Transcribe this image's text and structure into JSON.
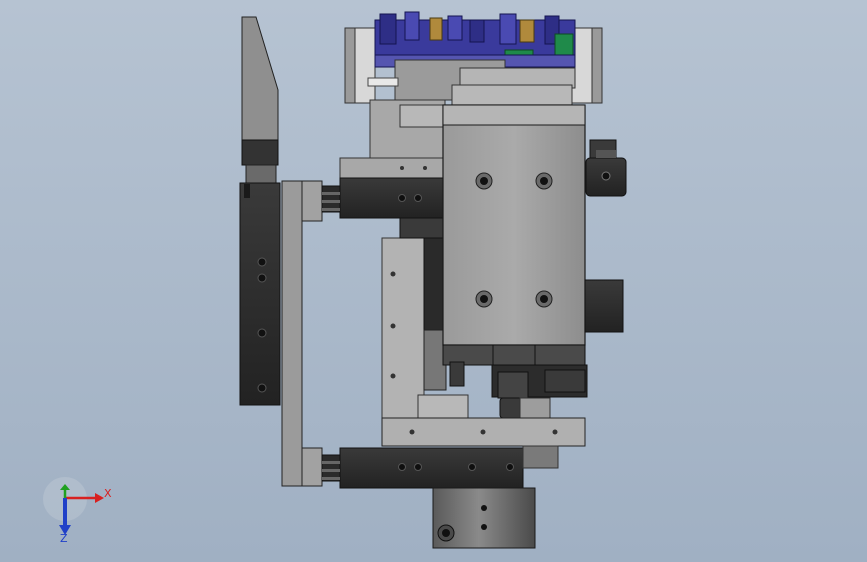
{
  "viewport": {
    "background_top": "#b6c3d2",
    "background_bottom": "#a0b0c3"
  },
  "model": {
    "palette": {
      "steel_light": "#a7a7a7",
      "steel_mid": "#8e8e8e",
      "steel_dark": "#5f5f5f",
      "block_black": "#2d2d2d",
      "edge": "#1a1a1a",
      "fixture_blue": "#3a3a9c",
      "fixture_green": "#1f8a4a",
      "fixture_tan": "#b08a3c"
    }
  },
  "triad": {
    "x_label": "X",
    "z_label": "Z",
    "x_color": "#d82020",
    "y_color": "#20a020",
    "z_color": "#2040c8"
  }
}
